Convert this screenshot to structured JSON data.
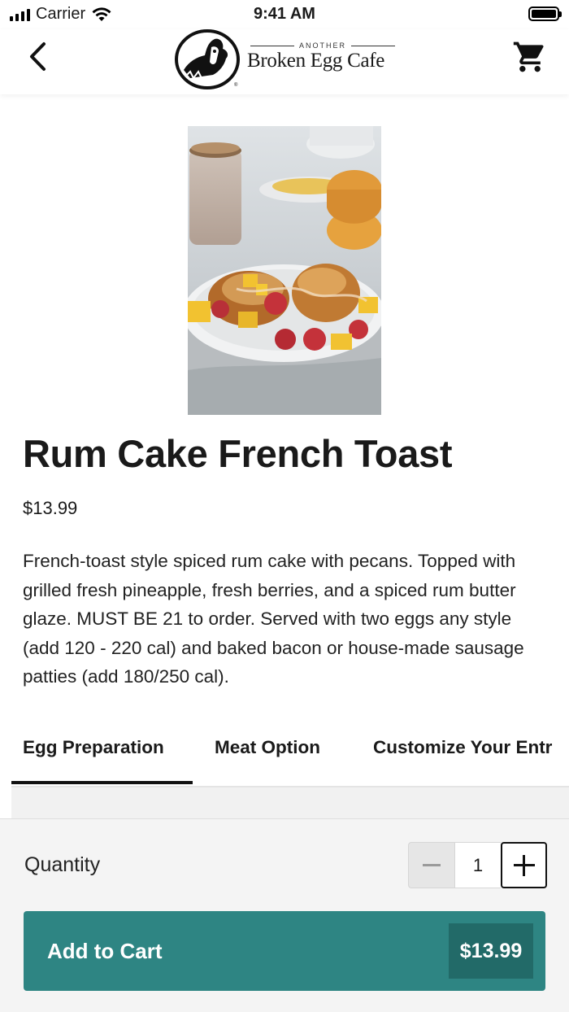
{
  "status_bar": {
    "carrier": "Carrier",
    "time": "9:41 AM"
  },
  "header": {
    "logo_small": "ANOTHER",
    "logo_name": "Broken Egg Cafe",
    "back_icon": "chevron-left-icon",
    "cart_icon": "shopping-cart-icon"
  },
  "product": {
    "title": "Rum Cake French Toast",
    "price": "$13.99",
    "description": "French-toast style spiced rum cake with pecans. Topped with grilled fresh pineapple, fresh berries, and a spiced rum butter glaze. MUST BE 21 to order. Served with two eggs any style (add 120 - 220 cal) and baked bacon or house-made sausage patties (add 180/250 cal)."
  },
  "tabs": [
    {
      "label": "Egg Preparation",
      "active": true
    },
    {
      "label": "Meat Option",
      "active": false
    },
    {
      "label": "Customize Your Entr",
      "active": false
    }
  ],
  "cart": {
    "quantity_label": "Quantity",
    "quantity": "1",
    "add_label": "Add to Cart",
    "total": "$13.99",
    "accent_color": "#2e8583"
  }
}
